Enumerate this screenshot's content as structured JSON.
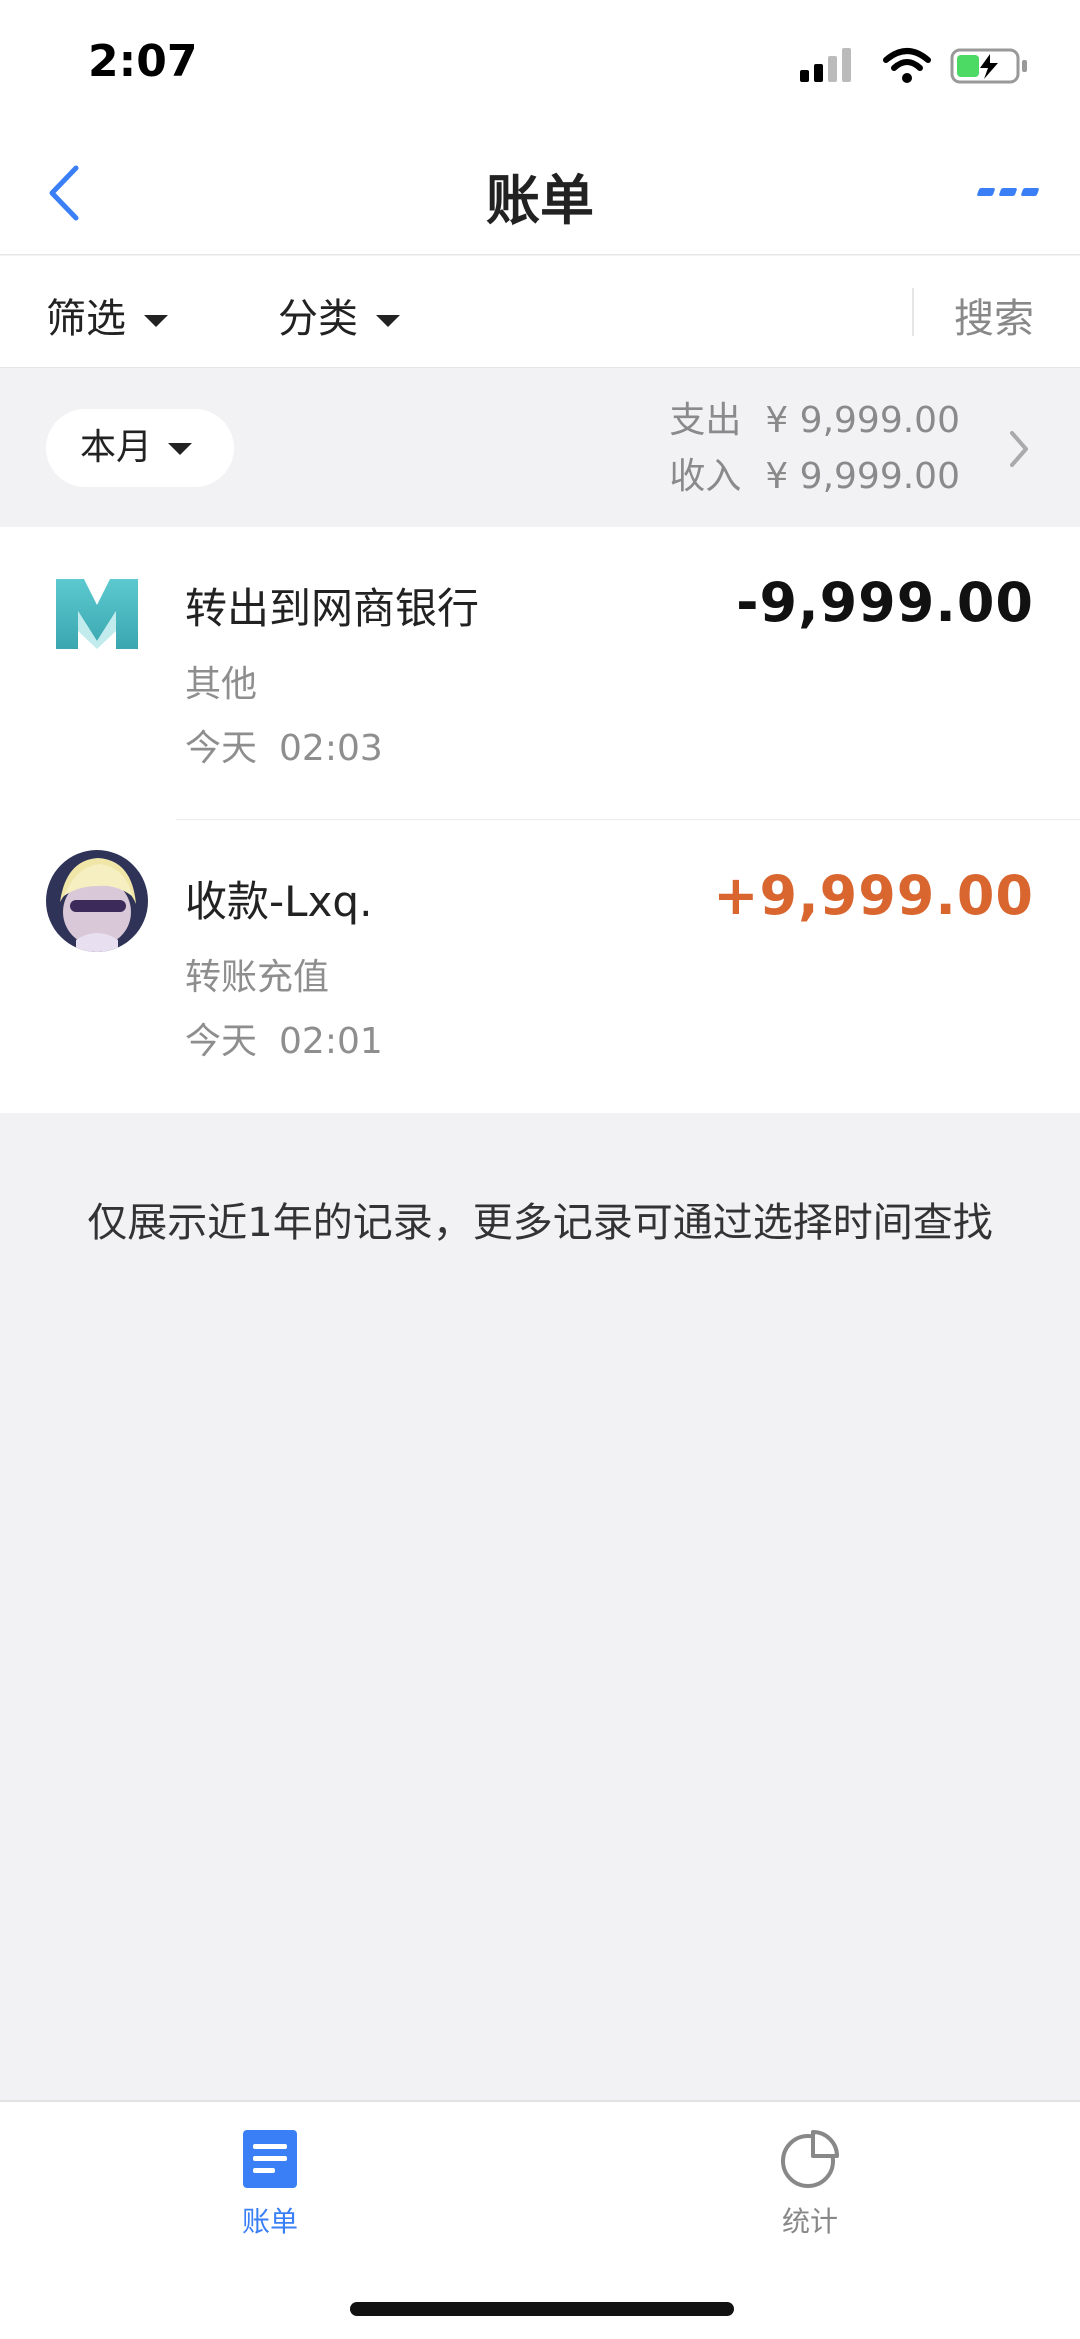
{
  "status_bar": {
    "time": "2:07"
  },
  "nav": {
    "title": "账单"
  },
  "filters": {
    "filter_label": "筛选",
    "category_label": "分类",
    "search_label": "搜索"
  },
  "month": {
    "selector_label": "本月",
    "expense_label": "支出",
    "expense_value": "¥ 9,999.00",
    "income_label": "收入",
    "income_value": "¥ 9,999.00"
  },
  "transactions": [
    {
      "title": "转出到网商银行",
      "category": "其他",
      "day": "今天",
      "time": "02:03",
      "amount": "-9,999.00",
      "icon": "mybank-logo-icon"
    },
    {
      "title": "收款-Lxq.",
      "category": "转账充值",
      "day": "今天",
      "time": "02:01",
      "amount": "+9,999.00",
      "icon": "user-avatar"
    }
  ],
  "notice": "仅展示近1年的记录，更多记录可通过选择时间查找",
  "tabs": [
    {
      "label": "账单",
      "icon": "bill-list-icon",
      "active": true
    },
    {
      "label": "统计",
      "icon": "pie-chart-icon",
      "active": false
    }
  ],
  "colors": {
    "accent": "#3a7ff6",
    "income": "#d9652f",
    "background": "#f2f2f5"
  }
}
